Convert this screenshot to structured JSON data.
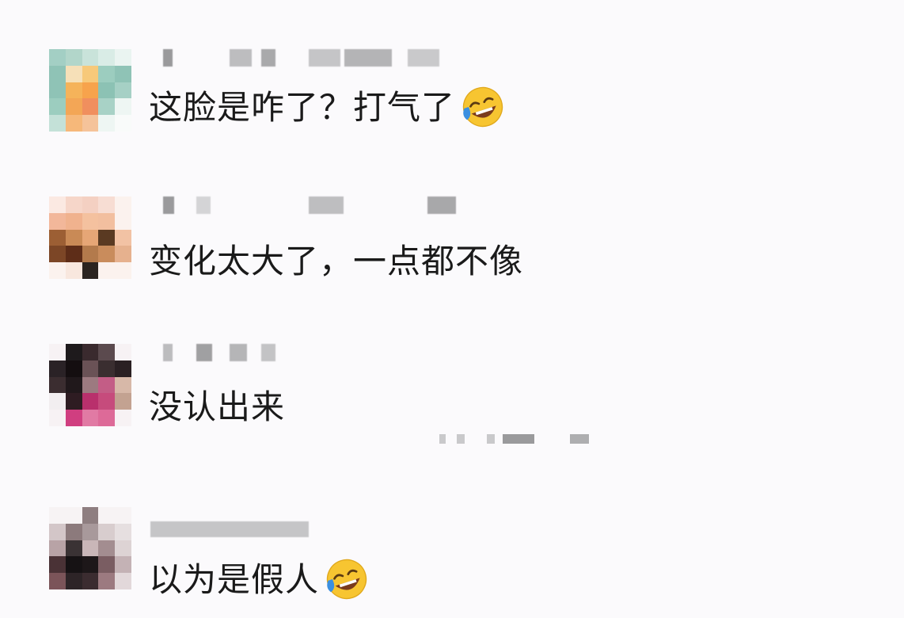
{
  "comments": [
    {
      "text": "这脸是咋了？打气了",
      "emoji": "rolling-on-floor-laughing",
      "username": ""
    },
    {
      "text": "变化太大了，一点都不像",
      "emoji": "",
      "username": ""
    },
    {
      "text": "没认出来",
      "emoji": "",
      "username": ""
    },
    {
      "text": "以为是假人",
      "emoji": "rolling-on-floor-laughing",
      "username": ""
    }
  ],
  "colors": {
    "background": "#fbfafc",
    "text": "#1a1a1a",
    "emoji_face": "#f7c531",
    "emoji_tear": "#3b8fe0"
  }
}
